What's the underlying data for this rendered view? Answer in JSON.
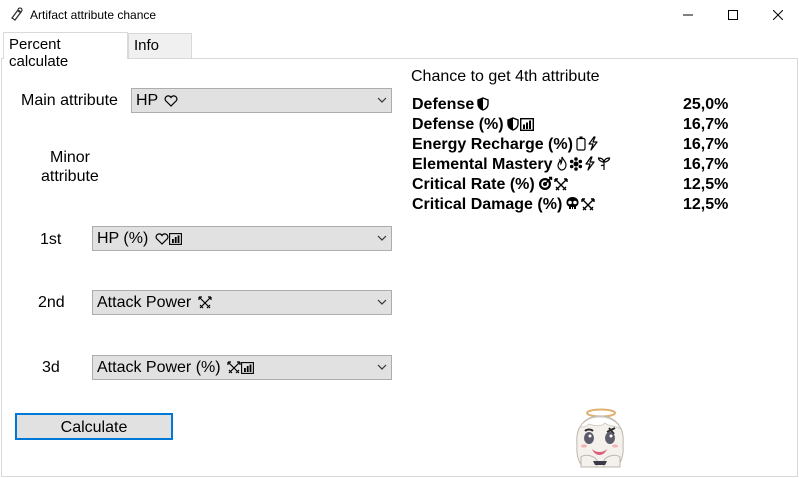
{
  "window": {
    "title": "Artifact attribute chance"
  },
  "tabs": [
    {
      "label": "Percent calculate",
      "active": true
    },
    {
      "label": "Info",
      "active": false
    }
  ],
  "form": {
    "main_attribute_label": "Main attribute",
    "main_attribute_value": "HP",
    "main_attribute_icons": [
      "heart-icon"
    ],
    "minor_attribute_label_line1": "Minor",
    "minor_attribute_label_line2": "attribute",
    "rows": [
      {
        "label": "1st",
        "value": "HP (%)",
        "icons": [
          "heart-icon",
          "percent-chart-icon"
        ]
      },
      {
        "label": "2nd",
        "value": "Attack Power",
        "icons": [
          "crossed-swords-icon"
        ]
      },
      {
        "label": "3d",
        "value": "Attack Power (%)",
        "icons": [
          "crossed-swords-icon",
          "percent-chart-icon"
        ]
      }
    ],
    "calculate_label": "Calculate"
  },
  "results": {
    "header": "Chance to get 4th attribute",
    "items": [
      {
        "name": "Defense",
        "value": "25,0%",
        "icons": [
          "shield-icon"
        ]
      },
      {
        "name": "Defense (%)",
        "value": "16,7%",
        "icons": [
          "shield-icon",
          "percent-chart-icon"
        ]
      },
      {
        "name": "Energy Recharge (%)",
        "value": "16,7%",
        "icons": [
          "battery-icon",
          "lightning-icon"
        ]
      },
      {
        "name": "Elemental Mastery",
        "value": "16,7%",
        "icons": [
          "flame-icon",
          "snowflake-icon",
          "lightning-icon",
          "leaf-icon"
        ]
      },
      {
        "name": "Critical Rate (%)",
        "value": "12,5%",
        "icons": [
          "target-icon",
          "crossed-swords-icon"
        ]
      },
      {
        "name": "Critical Damage (%)",
        "value": "12,5%",
        "icons": [
          "skull-icon",
          "crossed-swords-icon"
        ]
      }
    ]
  },
  "colors": {
    "combo_bg": "#e1e1e1",
    "button_focus_border": "#0078d7",
    "tab_border": "#d9d9d9"
  }
}
